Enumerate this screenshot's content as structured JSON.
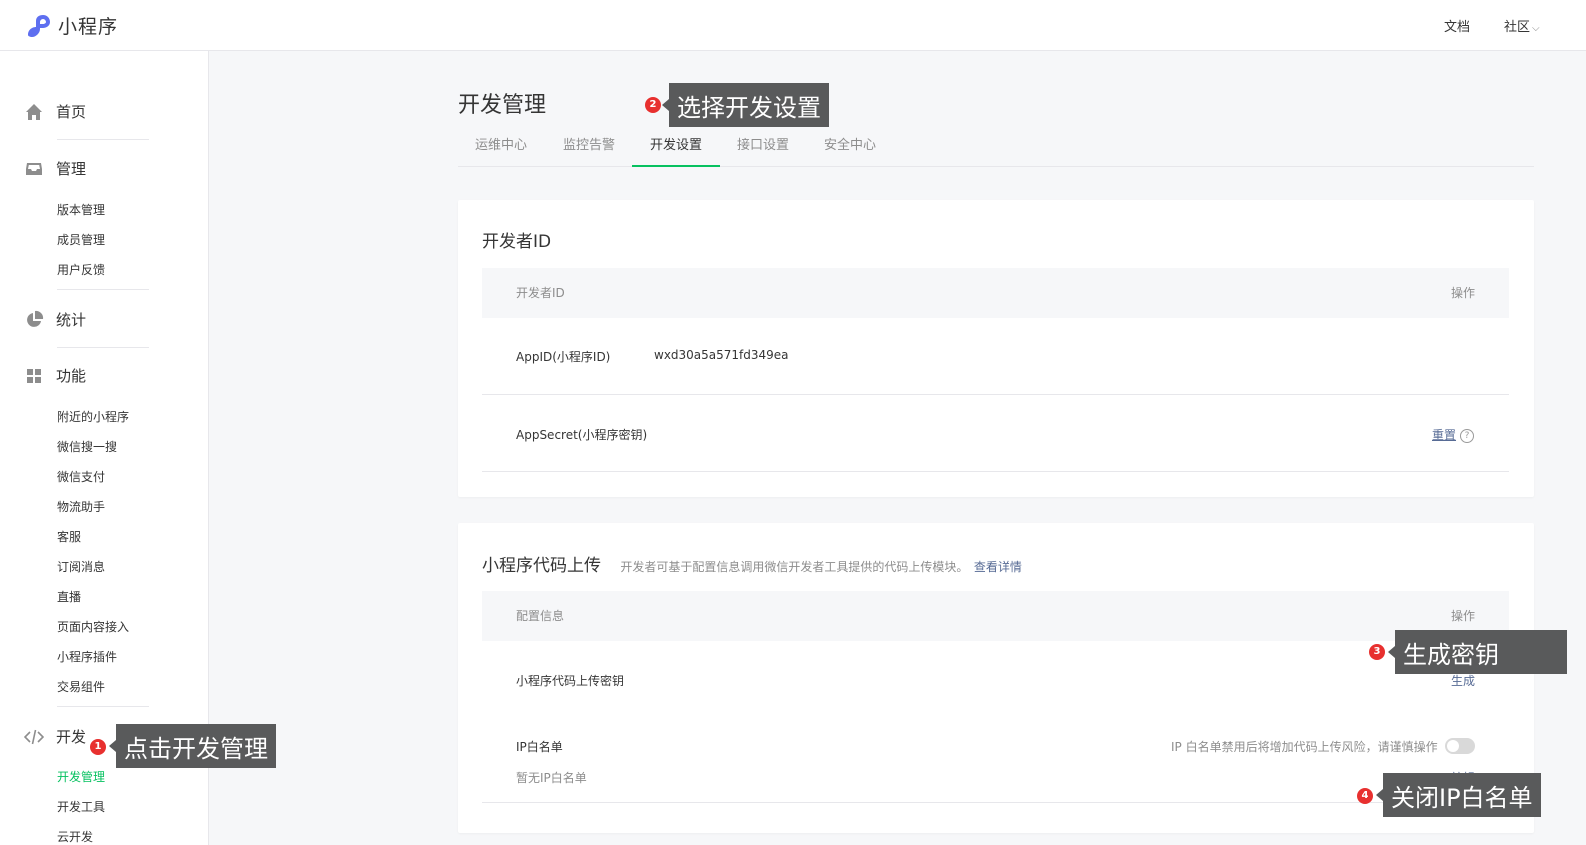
{
  "topbar": {
    "logo_text": "小程序",
    "docs_label": "文档",
    "community_label": "社区"
  },
  "sidebar": {
    "sections": {
      "home": "首页",
      "manage": "管理",
      "stats": "统计",
      "features": "功能",
      "dev": "开发"
    },
    "manage_items": [
      "版本管理",
      "成员管理",
      "用户反馈"
    ],
    "feature_items": [
      "附近的小程序",
      "微信搜一搜",
      "微信支付",
      "物流助手",
      "客服",
      "订阅消息",
      "直播",
      "页面内容接入",
      "小程序插件",
      "交易组件"
    ],
    "dev_items": [
      "开发管理",
      "开发工具",
      "云开发"
    ]
  },
  "main": {
    "title": "开发管理",
    "tabs": [
      "运维中心",
      "监控告警",
      "开发设置",
      "接口设置",
      "安全中心"
    ],
    "active_tab": "开发设置"
  },
  "dev_id_card": {
    "title": "开发者ID",
    "col_left": "开发者ID",
    "col_right": "操作",
    "appid_label": "AppID(小程序ID)",
    "appid_value": "wxd30a5a571fd349ea",
    "secret_label": "AppSecret(小程序密钥)",
    "reset_link": "重置",
    "help_glyph": "?"
  },
  "upload_card": {
    "title": "小程序代码上传",
    "desc": "开发者可基于配置信息调用微信开发者工具提供的代码上传模块。",
    "desc_link": "查看详情",
    "col_left": "配置信息",
    "col_right": "操作",
    "key_label": "小程序代码上传密钥",
    "generate_link": "生成",
    "ip_label": "IP白名单",
    "ip_empty": "暂无IP白名单",
    "ip_warning": "IP 白名单禁用后将增加代码上传风险，请谨慎操作",
    "edit_link": "编辑",
    "ip_toggle_on": false
  },
  "callouts": {
    "c1": {
      "num": "1",
      "text": "点击开发管理"
    },
    "c2": {
      "num": "2",
      "text": "选择开发设置"
    },
    "c3": {
      "num": "3",
      "text": "生成密钥"
    },
    "c4": {
      "num": "4",
      "text": "关闭IP白名单"
    }
  },
  "colors": {
    "accent": "#07c160",
    "link": "#576b95",
    "badge": "#e8302f",
    "callout_bg": "#595a5b"
  }
}
